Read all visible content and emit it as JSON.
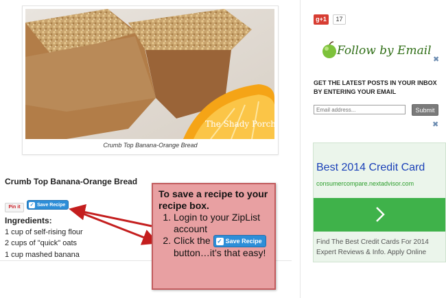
{
  "photo": {
    "watermark": "The Shady Porch",
    "caption": "Crumb Top Banana-Orange Bread"
  },
  "recipe": {
    "title": "Crumb Top Banana-Orange Bread",
    "pin_label": "Pin it",
    "save_label": "Save Recipe",
    "ingredients_heading": "Ingredients:",
    "ingredients": [
      "1 cup of self-rising flour",
      "2 cups of \"quick\" oats",
      "1 cup mashed banana"
    ]
  },
  "callout": {
    "heading": "To save a recipe to your recipe box.",
    "step1": "Login to your ZipList account",
    "step2_before": "Click the",
    "step2_after": "button…it’s that easy!",
    "save_label": "Save Recipe"
  },
  "sidebar": {
    "gplus_label": "g+1",
    "gplus_count": "17",
    "follow_title": "Follow by Email",
    "follow_desc": "GET THE LATEST POSTS IN YOUR INBOX BY ENTERING YOUR EMAIL",
    "email_placeholder": "Email address...",
    "submit_label": "Submit",
    "wrench_icon": "wrench-icon"
  },
  "ad": {
    "title": "Best 2014 Credit Card",
    "url": "consumercompare.nextadvisor.com",
    "desc_line1": "Find The Best Credit Cards For 2014",
    "desc_line2": "Expert Reviews & Info. Apply Online"
  },
  "colors": {
    "callout_bg": "#e8a0a2",
    "arrow": "#c41e1e",
    "save_button": "#2d8ed8",
    "ad_green": "#3fb24a",
    "ad_link": "#1a40b8"
  }
}
